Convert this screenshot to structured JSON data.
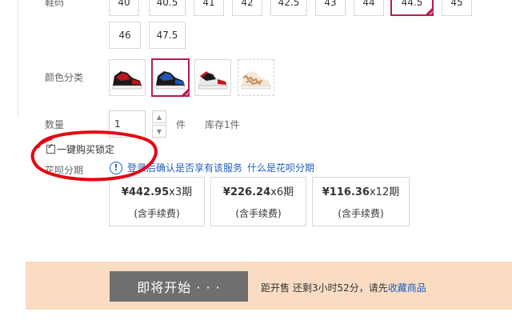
{
  "product": {
    "size_label": "鞋码",
    "sizes_row1": [
      "40",
      "40.5",
      "41",
      "42",
      "42.5",
      "43",
      "44",
      "44.5",
      "45"
    ],
    "sizes_row2": [
      "46",
      "47.5"
    ],
    "selected_size": "44.5",
    "color_label": "颜色分类",
    "colors": [
      "black-red",
      "black-royal-blue",
      "white-black-red",
      "tan-pattern"
    ],
    "selected_color_index": 1
  },
  "quantity": {
    "label": "数量",
    "value": "1",
    "unit": "件",
    "stock": "库存1件"
  },
  "one_click_lock": {
    "checked": true,
    "label": "一键购买锁定"
  },
  "huabei": {
    "label": "花呗分期",
    "notice_text": "登录后确认是否享有该服务",
    "notice_link": "什么是花呗分期",
    "options": [
      {
        "amount": "¥442.95",
        "periods": "x3期",
        "fee": "(含手续费)"
      },
      {
        "amount": "¥226.24",
        "periods": "x6期",
        "fee": "(含手续费)"
      },
      {
        "amount": "¥116.36",
        "periods": "x12期",
        "fee": "(含手续费)"
      }
    ]
  },
  "bottom": {
    "start_button": "即将开始 · · ·",
    "presale_text": "距开售 还剩3小时52分，请先",
    "favorite_link": "收藏商品"
  },
  "colors_theme": {
    "accent": "#b81c4c",
    "annotation_red": "#e30613",
    "link": "#1f5fbf",
    "bottom_bar": "#f9dcc2",
    "start_button": "#6f6f6f"
  }
}
